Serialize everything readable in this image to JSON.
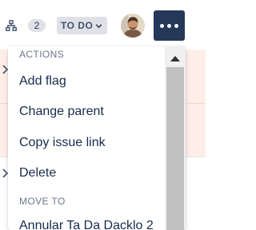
{
  "issue_row": {
    "child_count": "2",
    "status": "TO DO",
    "avatar_alt": "assignee"
  },
  "menu": {
    "groups": [
      {
        "heading": "ACTIONS",
        "items": [
          "Add flag",
          "Change parent",
          "Copy issue link",
          "Delete"
        ]
      },
      {
        "heading": "MOVE TO",
        "items": [
          "Annular Ta Da Dacklo 2"
        ]
      }
    ]
  },
  "colors": {
    "highlight_row": "#ffeee8",
    "more_button": "#253858",
    "badge": "#dfe1e6"
  }
}
